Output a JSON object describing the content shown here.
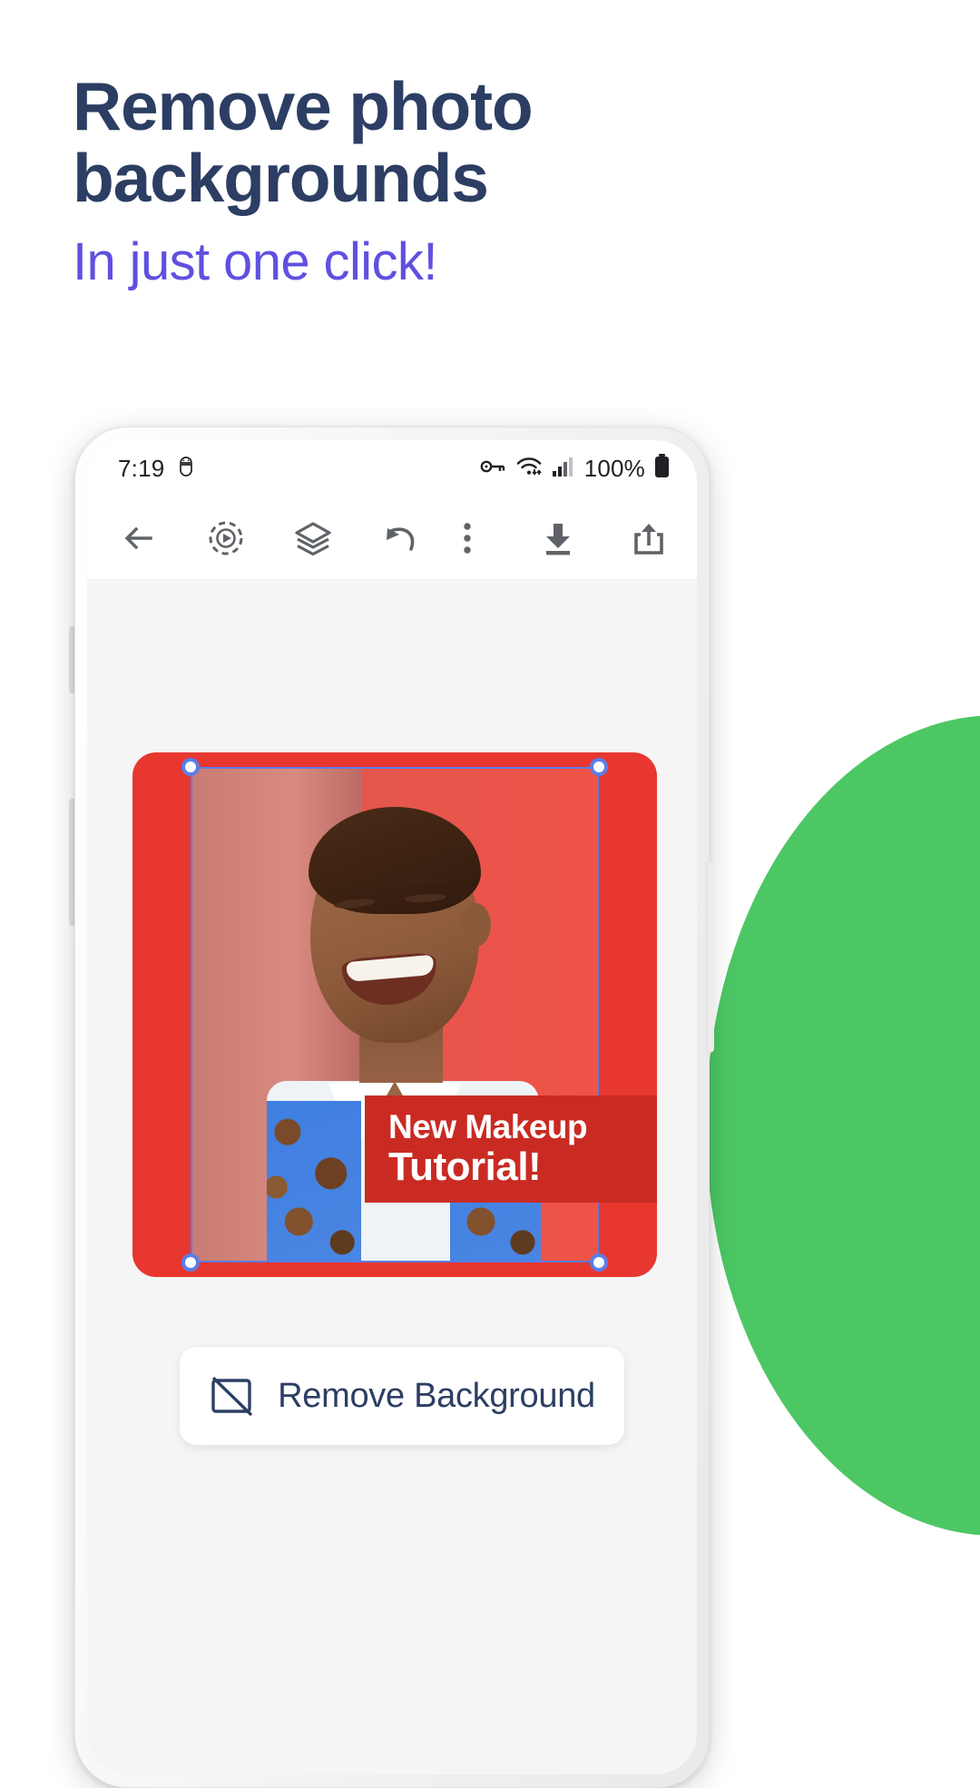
{
  "promo": {
    "headline_line1": "Remove photo",
    "headline_line2": "backgrounds",
    "subheadline": "In just one click!",
    "headline_color": "#2c3e63",
    "subheadline_color": "#6050e0",
    "accent_green": "#4cc764"
  },
  "phone": {
    "status_bar": {
      "time": "7:19",
      "android_icon": "android-head-icon",
      "vpn_icon": "vpn-key-icon",
      "wifi_icon": "wifi-icon",
      "signal_icon": "cell-signal-icon",
      "battery_text": "100%",
      "battery_icon": "battery-full-icon"
    },
    "toolbar": {
      "back": "back-arrow-icon",
      "animate": "animate-play-icon",
      "layers": "layers-icon",
      "undo": "undo-icon",
      "more": "more-vertical-icon",
      "download": "download-icon",
      "share": "share-icon"
    },
    "canvas": {
      "photo_background_color": "#e8372f",
      "selection_color": "#5b7de8",
      "banner": {
        "line1": "New Makeup",
        "line2": "Tutorial!",
        "background_color": "#c92b23",
        "text_color": "#ffffff"
      }
    },
    "action_button": {
      "label": "Remove Background",
      "icon": "remove-background-icon"
    }
  }
}
